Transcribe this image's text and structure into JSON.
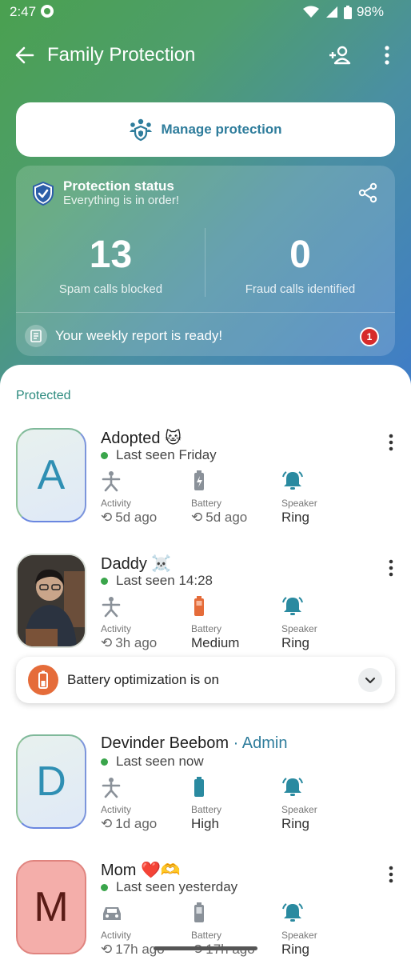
{
  "status_bar": {
    "time": "2:47",
    "battery": "98%"
  },
  "app_bar": {
    "title": "Family Protection"
  },
  "manage": {
    "label": "Manage protection"
  },
  "status_card": {
    "title": "Protection status",
    "subtitle": "Everything is in order!",
    "stats": [
      {
        "value": "13",
        "label": "Spam calls blocked"
      },
      {
        "value": "0",
        "label": "Fraud calls identified"
      }
    ],
    "report": {
      "text": "Your weekly report is ready!",
      "badge": "1"
    }
  },
  "section": {
    "title": "Protected"
  },
  "members": [
    {
      "initial": "A",
      "name": "Adopted 🐱",
      "seen": "Last seen Friday",
      "activity": {
        "label": "Activity",
        "value": "5d ago"
      },
      "battery": {
        "label": "Battery",
        "value": "5d ago"
      },
      "speaker": {
        "label": "Speaker",
        "value": "Ring"
      }
    },
    {
      "initial": "",
      "name": "Daddy ☠️",
      "seen": "Last seen 14:28",
      "activity": {
        "label": "Activity",
        "value": "3h ago"
      },
      "battery": {
        "label": "Battery",
        "value": "Medium"
      },
      "speaker": {
        "label": "Speaker",
        "value": "Ring"
      }
    },
    {
      "initial": "D",
      "name": "Devinder Beebom",
      "role": "· Admin",
      "seen": "Last seen now",
      "activity": {
        "label": "Activity",
        "value": "1d ago"
      },
      "battery": {
        "label": "Battery",
        "value": "High"
      },
      "speaker": {
        "label": "Speaker",
        "value": "Ring"
      }
    },
    {
      "initial": "M",
      "name": "Mom ❤️🫶",
      "seen": "Last seen yesterday",
      "activity": {
        "label": "Activity",
        "value": "17h ago"
      },
      "battery": {
        "label": "Battery",
        "value": "17h ago"
      },
      "speaker": {
        "label": "Speaker",
        "value": "Ring"
      }
    }
  ],
  "alert": {
    "text": "Battery optimization is on"
  },
  "icons": {
    "back": "arrow-left-icon",
    "add_user": "add-person-icon",
    "more": "more-vertical-icon",
    "manage": "family-shield-icon",
    "shield": "shield-check-icon",
    "share": "share-icon",
    "activity": "person-walk-icon",
    "car": "car-icon",
    "battery": "battery-icon",
    "speaker": "bell-ring-icon",
    "sync": "sync-icon",
    "chevron": "chevron-down-icon"
  },
  "colors": {
    "accent": "#2f7d9c",
    "green": "#3aa54b",
    "alert": "#e56c3a",
    "badge": "#d62b2b"
  }
}
